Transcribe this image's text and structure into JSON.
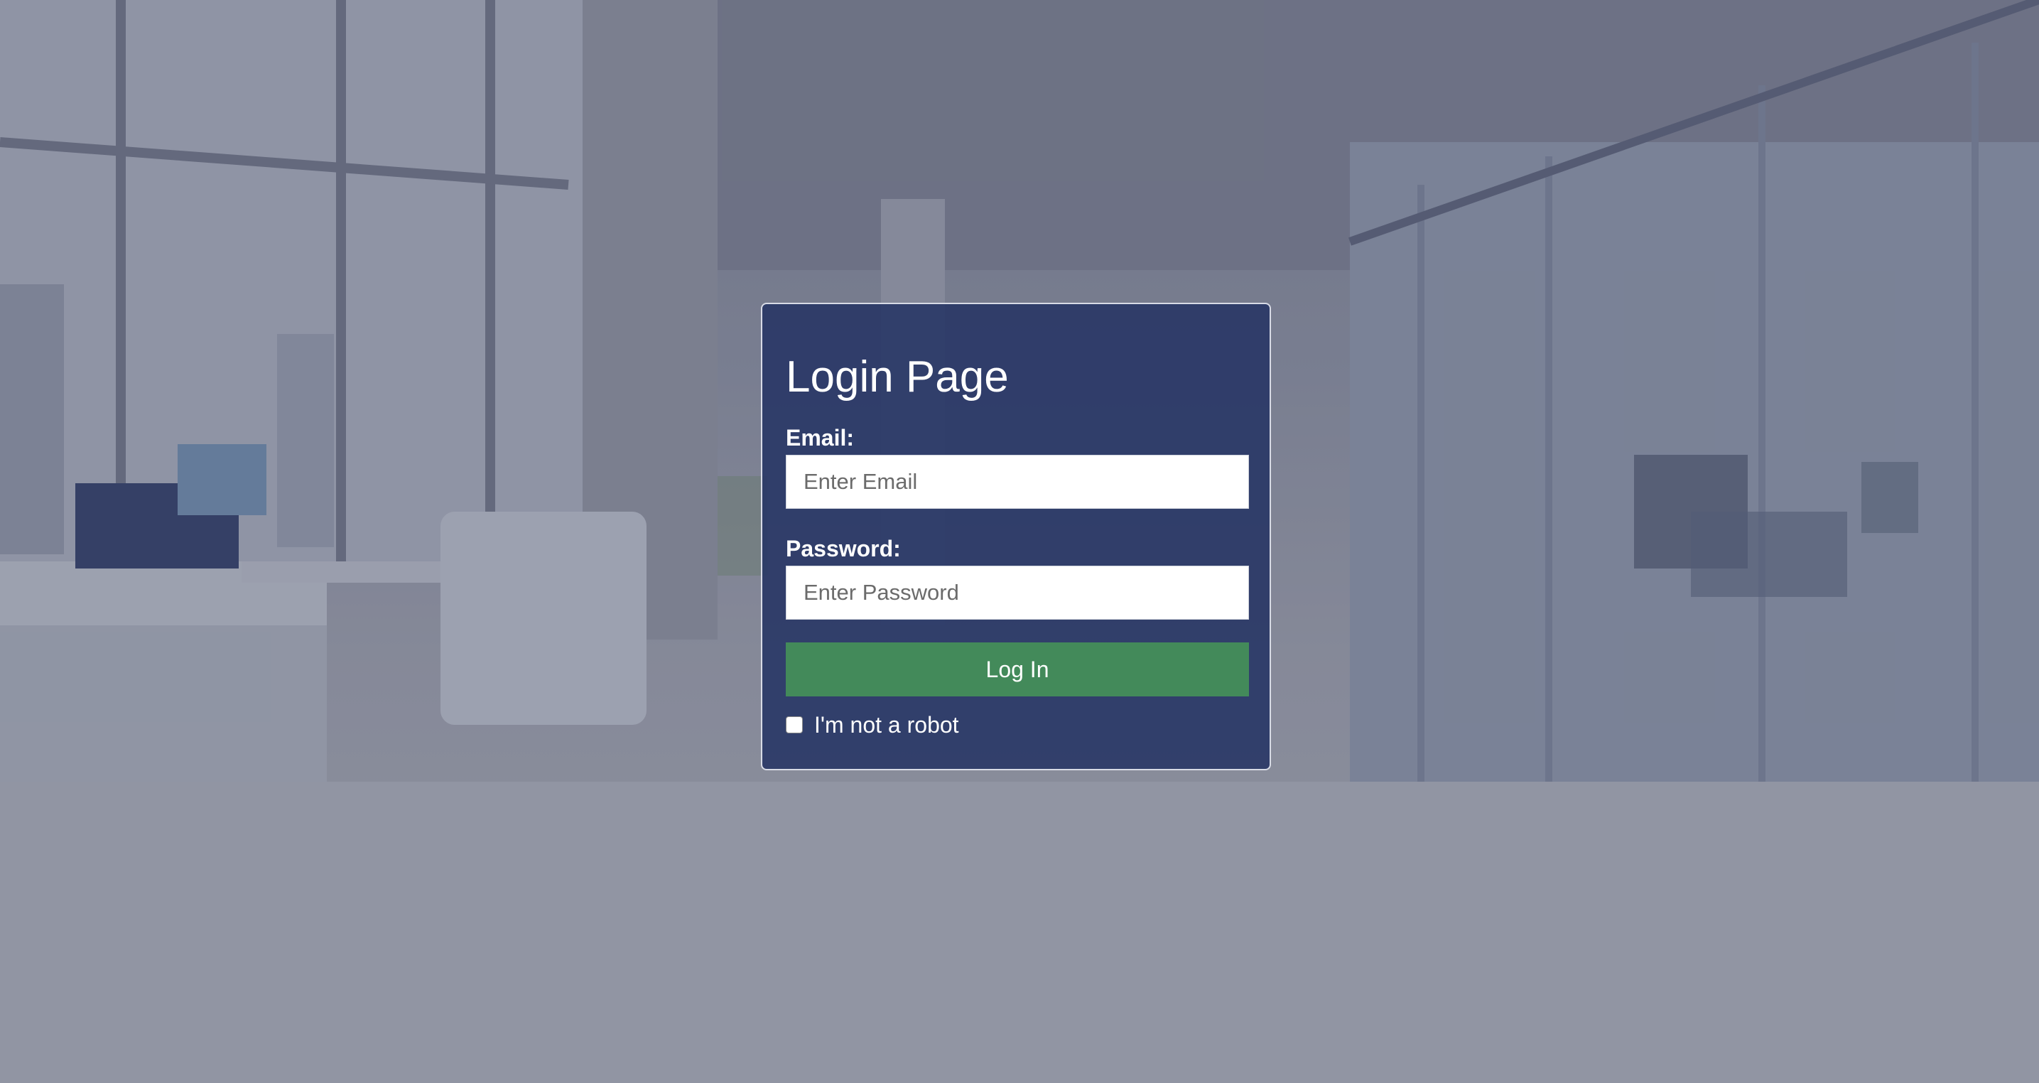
{
  "login": {
    "title": "Login Page",
    "email_label": "Email:",
    "email_placeholder": "Enter Email",
    "email_value": "",
    "password_label": "Password:",
    "password_placeholder": "Enter Password",
    "password_value": "",
    "submit_label": "Log In",
    "robot_label": "I'm not a robot",
    "robot_checked": false
  },
  "colors": {
    "card_background": "#263464",
    "button_background": "#438a5a",
    "text": "#ffffff"
  }
}
